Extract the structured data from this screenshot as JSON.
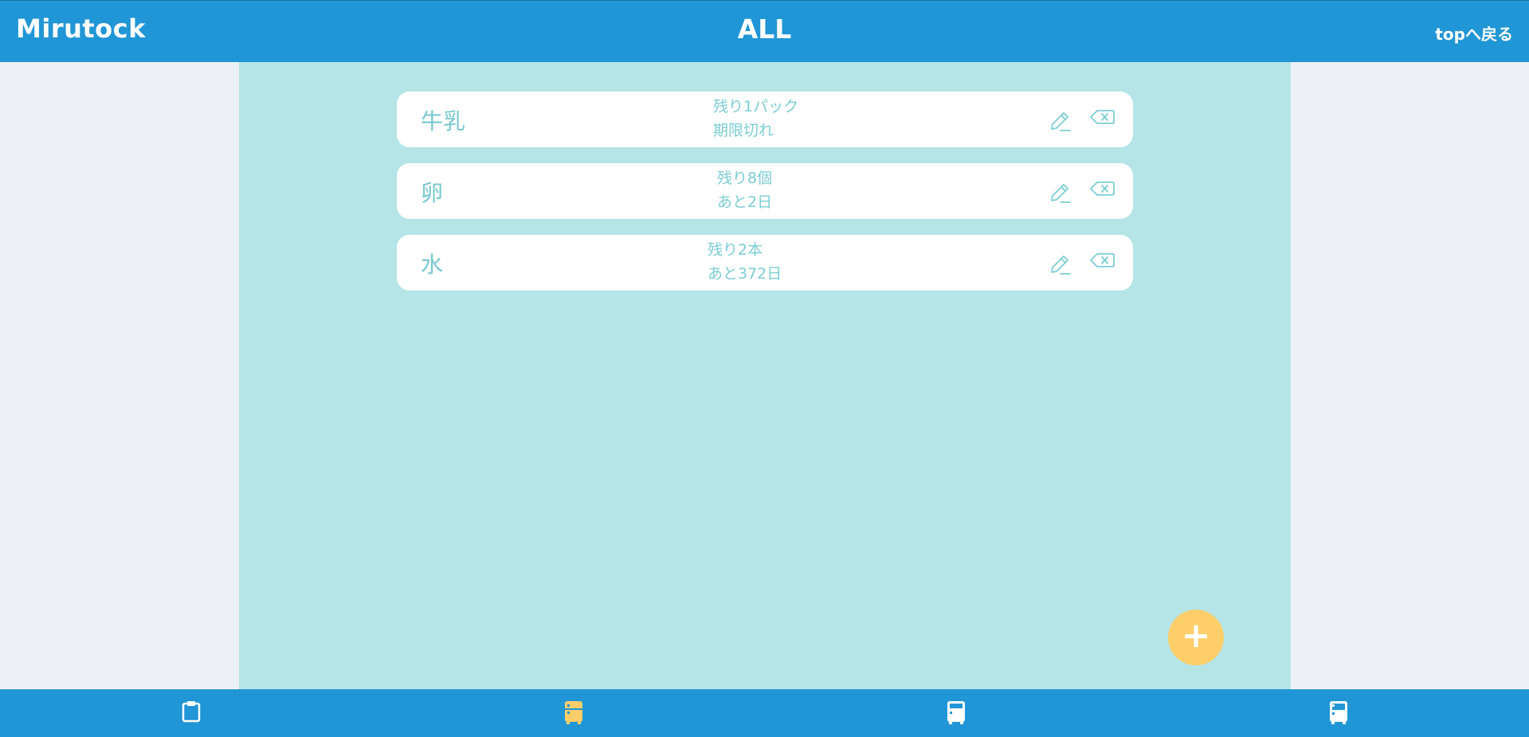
{
  "header": {
    "app_title": "Mirutock",
    "page_title": "ALL",
    "back_link": "topへ戻る"
  },
  "items": [
    {
      "name": "牛乳",
      "remaining": "残り1パック",
      "expiry": "期限切れ"
    },
    {
      "name": "卵",
      "remaining": "残り8個",
      "expiry": "あと2日"
    },
    {
      "name": "水",
      "remaining": "残り2本",
      "expiry": "あと372日"
    }
  ],
  "fab": {
    "label": "+"
  },
  "bottom_nav": [
    {
      "icon": "clipboard-icon",
      "active": false
    },
    {
      "icon": "fridge-icon",
      "active": true
    },
    {
      "icon": "fridge-icon",
      "active": false
    },
    {
      "icon": "fridge-icon",
      "active": false
    }
  ],
  "colors": {
    "header_bg": "#2196d6",
    "panel_bg": "#b5e5e6",
    "page_bg": "#edf1f6",
    "item_text": "#78c8cf",
    "accent": "#ffce6b",
    "nav_icon": "#ffffff",
    "nav_icon_active": "#ffce6b"
  }
}
